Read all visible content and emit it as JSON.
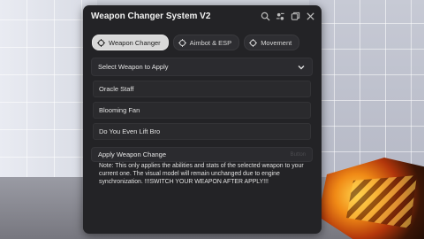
{
  "window": {
    "title": "Weapon Changer System V2",
    "icons": [
      "search-icon",
      "settings-icon",
      "window-icon",
      "close-icon"
    ]
  },
  "tabs": [
    {
      "label": "Weapon Changer",
      "active": true,
      "icon": "target-icon"
    },
    {
      "label": "Aimbot & ESP",
      "active": false,
      "icon": "target-icon"
    },
    {
      "label": "Movement",
      "active": false,
      "icon": "target-icon"
    }
  ],
  "dropdown": {
    "label": "Select Weapon to Apply",
    "icon": "chevron-down-icon",
    "options": [
      "Oracle Staff",
      "Blooming Fan",
      "Do You Even Lift Bro"
    ]
  },
  "apply": {
    "label": "Apply Weapon Change",
    "hint": "Button"
  },
  "note": "Note: This only applies the abilities and stats of the selected weapon to your current one. The visual model will remain unchanged due to engine synchronization. !!!SWITCH YOUR WEAPON AFTER APPLY!!!",
  "colors": {
    "window_bg": "#232326",
    "tab_active_bg": "#d8d8d8",
    "item_bg": "#2a2a2d"
  }
}
